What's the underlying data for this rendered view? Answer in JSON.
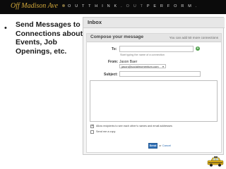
{
  "header": {
    "brand": "Off Madison Ave",
    "tagline_parts": [
      "O U T",
      "T H I N K .",
      "O U T",
      "P E R F O R M ."
    ]
  },
  "slide": {
    "bullet": "•",
    "text": "Send Messages to Connections about Events, Job Openings, etc."
  },
  "inbox": {
    "tab_label": "Inbox",
    "compose_title": "Compose your message",
    "limit_note": "You can add 50 more connections",
    "to_label": "To:",
    "to_value": "",
    "to_hint": "Start typing the name of a connection",
    "from_label": "From:",
    "from_name": "Jason Baer",
    "from_email": "jason@socialmomentum.com",
    "subject_label": "Subject:",
    "subject_value": "",
    "body_value": "",
    "option_allow": "Allow recipients to see each other's names and email addresses",
    "option_allow_checked": true,
    "option_copy": "Send me a copy",
    "option_copy_checked": false,
    "send_label": "Send",
    "or_text": "or",
    "cancel_label": "Cancel"
  },
  "colors": {
    "header_bg": "#0b0b0b",
    "brand": "#d2a83a",
    "send_button": "#2f6fb5"
  },
  "icons": {
    "add_connection": "add-connection-icon",
    "taxi": "taxi-icon"
  }
}
